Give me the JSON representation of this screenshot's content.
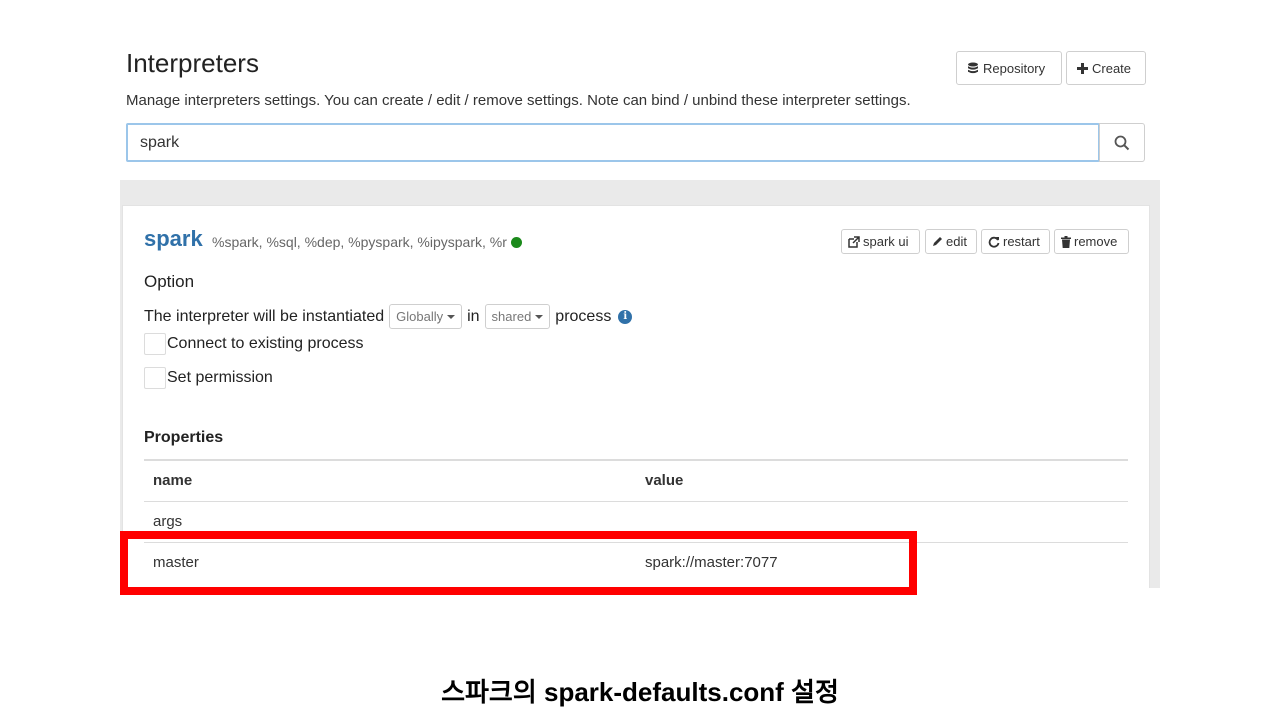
{
  "header": {
    "title": "Interpreters",
    "description": "Manage interpreters settings. You can create / edit / remove settings. Note can bind / unbind these interpreter settings.",
    "repository_label": "Repository",
    "create_label": "Create"
  },
  "search": {
    "value": "spark"
  },
  "interpreter": {
    "name": "spark",
    "tags": "%spark, %sql, %dep, %pyspark, %ipyspark, %r",
    "status_color": "#1b8a1b",
    "actions": {
      "spark_ui": "spark ui",
      "edit": "edit",
      "restart": "restart",
      "remove": "remove"
    },
    "option": {
      "title": "Option",
      "sentence_start": "The interpreter will be instantiated",
      "scope_value": "Globally",
      "in_word": "in",
      "mode_value": "shared",
      "process_word": "process",
      "connect_existing": "Connect to existing process",
      "set_permission": "Set permission"
    },
    "properties": {
      "title": "Properties",
      "headers": [
        "name",
        "value"
      ],
      "rows": [
        {
          "name": "args",
          "value": ""
        },
        {
          "name": "master",
          "value": "spark://master:7077"
        }
      ]
    }
  },
  "highlight_color": "#ff0000",
  "caption": "스파크의 spark-defaults.conf 설정"
}
